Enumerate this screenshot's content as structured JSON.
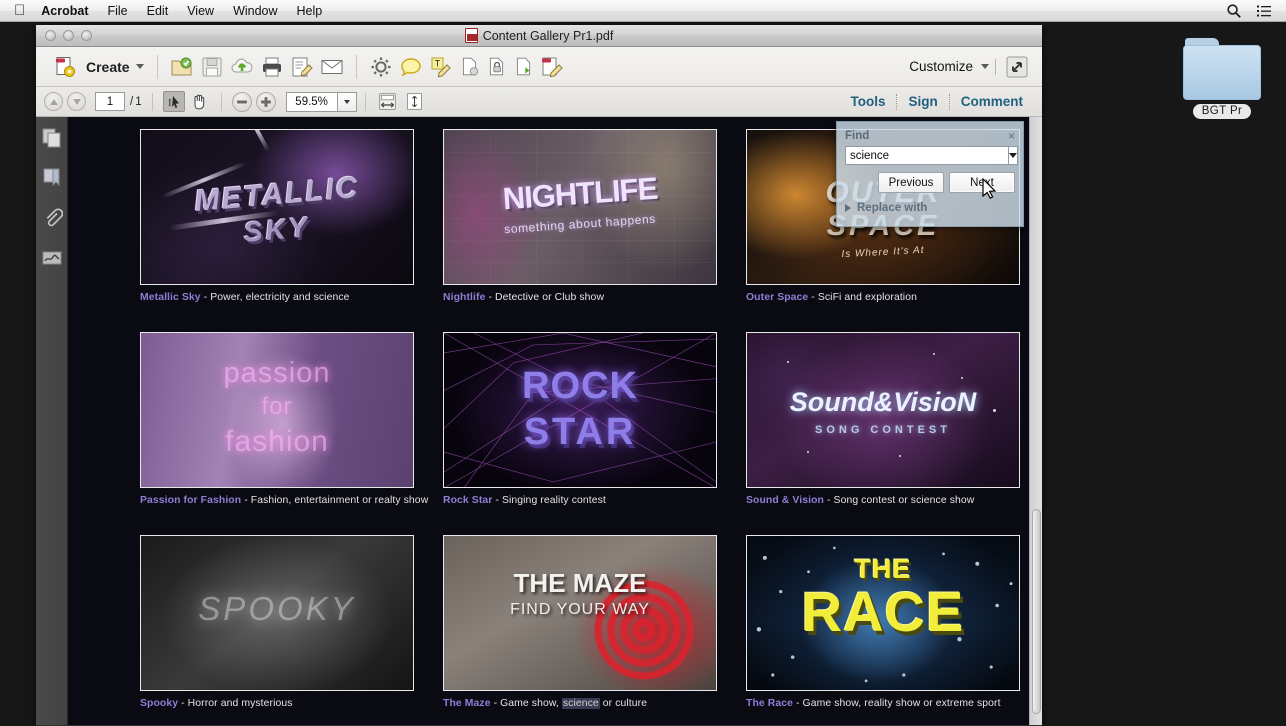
{
  "menubar": {
    "apple": "",
    "items": [
      {
        "label": "Acrobat",
        "bold": true
      },
      {
        "label": "File",
        "bold": false
      },
      {
        "label": "Edit",
        "bold": false
      },
      {
        "label": "View",
        "bold": false
      },
      {
        "label": "Window",
        "bold": false
      },
      {
        "label": "Help",
        "bold": false
      }
    ],
    "right_icons": [
      "search-icon",
      "list-icon"
    ]
  },
  "desktop": {
    "folder_label": "BGT Pr",
    "folder_color": "#bcd6ec"
  },
  "window": {
    "title": "Content Gallery Pr1.pdf",
    "traffic_lights": [
      "close",
      "minimize",
      "zoom"
    ]
  },
  "toolbar": {
    "create_label": "Create",
    "customize_label": "Customize",
    "icons_left": [
      "open-file-icon",
      "save-icon",
      "upload-cloud-icon",
      "print-icon",
      "edit-document-icon",
      "email-icon"
    ],
    "icons_right": [
      "settings-gear-icon",
      "comment-bubble-icon",
      "highlight-text-icon",
      "page-stamp-icon",
      "secure-page-icon",
      "export-page-icon",
      "edit-pdf-icon"
    ],
    "expand_icon": "expand-arrows-icon"
  },
  "navbar": {
    "page_current": "1",
    "page_separator": "/",
    "page_total": "1",
    "zoom_level": "59.5%",
    "select_tool": "select-tool-icon",
    "hand_tool": "hand-tool-icon",
    "zoom_out": "zoom-out-icon",
    "zoom_in": "zoom-in-icon",
    "fit_width_icon": "fit-width-icon",
    "fit_page_icon": "fit-page-icon",
    "links": [
      "Tools",
      "Sign",
      "Comment"
    ],
    "link_color": "#21607f"
  },
  "sidebar": {
    "items": [
      {
        "name": "page-thumbnails-icon"
      },
      {
        "name": "bookmarks-icon"
      },
      {
        "name": "attachments-icon"
      },
      {
        "name": "signatures-icon"
      }
    ]
  },
  "find": {
    "title": "Find",
    "close_label": "×",
    "query": "science",
    "placeholder": "Find",
    "previous_label": "Previous",
    "next_label": "Next",
    "replace_label": "Replace with"
  },
  "gallery": {
    "items": [
      {
        "id": "metallic-sky",
        "title": "Metallic Sky",
        "desc": " - Power, electricity and science",
        "art_title_1": "METALLIC",
        "art_title_2": "SKY"
      },
      {
        "id": "nightlife",
        "title": "Nightlife",
        "desc": " - Detective or Club show",
        "art_title_1": "NIGHTLIFE",
        "art_title_2": "something about happens"
      },
      {
        "id": "outer-space",
        "title": "Outer Space",
        "desc": " - SciFi and exploration",
        "art_title_1": "OUTER",
        "art_title_2": "SPACE",
        "art_title_3": "Is Where It's At"
      },
      {
        "id": "passion-for-fashion",
        "title": "Passion for Fashion",
        "desc": " - Fashion, entertainment or realty show",
        "art_title_1": "passion",
        "art_title_2": "for",
        "art_title_3": "fashion"
      },
      {
        "id": "rock-star",
        "title": "Rock Star",
        "desc": " - Singing reality contest",
        "art_title_1": "ROCK",
        "art_title_2": "STAR"
      },
      {
        "id": "sound-and-vision",
        "title": "Sound & Vision",
        "desc": " - Song contest or science show",
        "art_title_1": "Sound&VisioN",
        "art_title_2": "SONG CONTEST"
      },
      {
        "id": "spooky",
        "title": "Spooky",
        "desc": " - Horror and mysterious",
        "art_title_1": "SPOOKY"
      },
      {
        "id": "the-maze",
        "title": "The Maze",
        "desc_pre": " - Game show, ",
        "desc_highlight": "science",
        "desc_post": " or culture",
        "art_title_1": "THE MAZE",
        "art_title_2": "FIND YOUR WAY"
      },
      {
        "id": "the-race",
        "title": "The Race",
        "desc": " - Game show, reality show or extreme sport",
        "art_title_1": "THE",
        "art_title_2": "RACE"
      }
    ],
    "title_color": "#8e7fd6",
    "text_color": "#e4e4e4"
  }
}
